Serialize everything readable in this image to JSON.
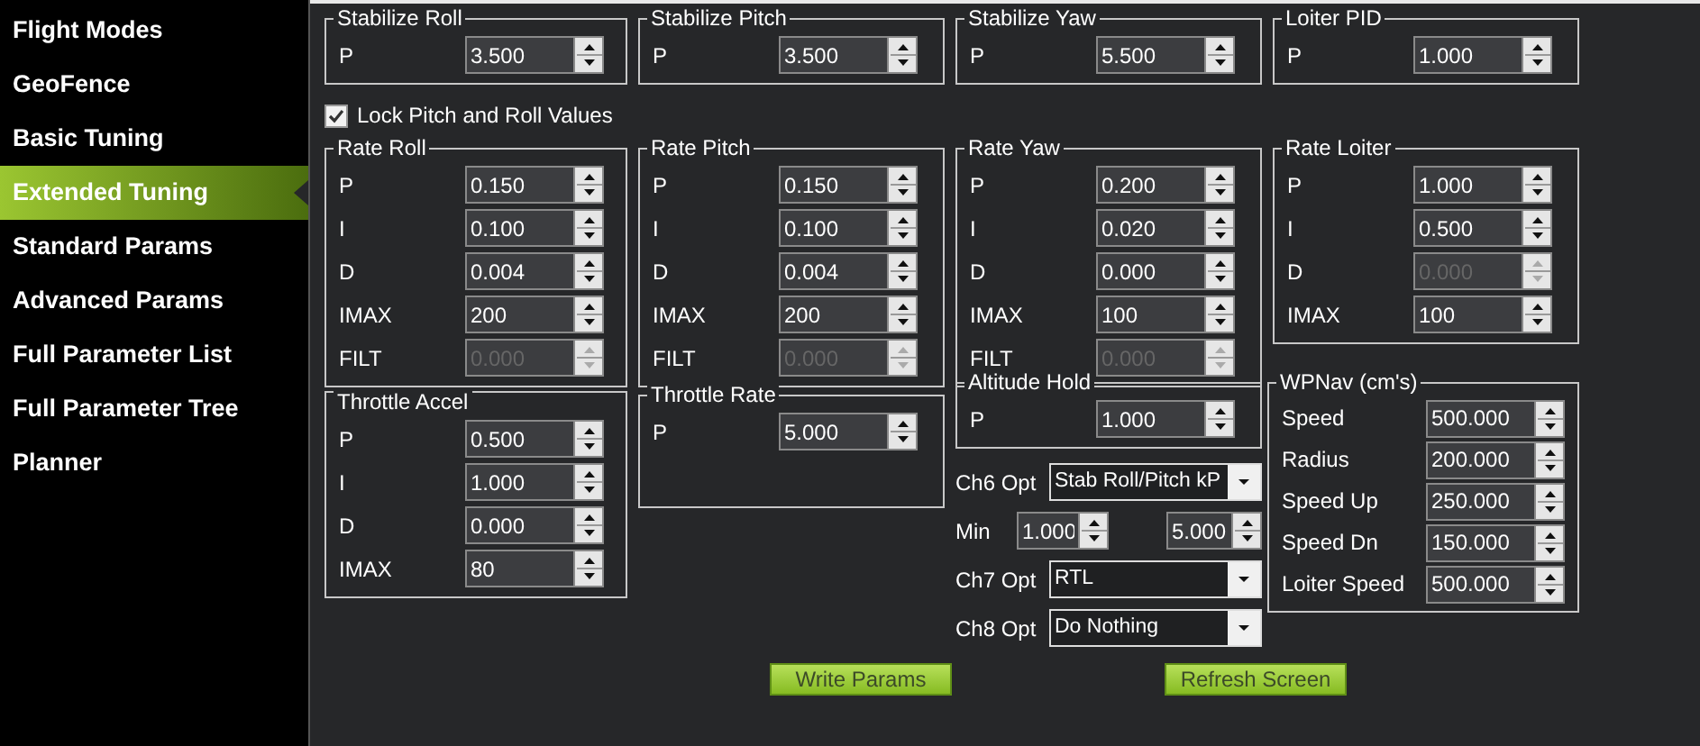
{
  "sidebar": {
    "items": [
      {
        "label": "Flight Modes",
        "selected": false
      },
      {
        "label": "GeoFence",
        "selected": false
      },
      {
        "label": "Basic Tuning",
        "selected": false
      },
      {
        "label": "Extended Tuning",
        "selected": true
      },
      {
        "label": "Standard Params",
        "selected": false
      },
      {
        "label": "Advanced Params",
        "selected": false
      },
      {
        "label": "Full Parameter List",
        "selected": false
      },
      {
        "label": "Full Parameter Tree",
        "selected": false
      },
      {
        "label": "Planner",
        "selected": false
      }
    ]
  },
  "groups_top": [
    {
      "title": "Stabilize Roll",
      "fields": [
        {
          "label": "P",
          "value": "3.500",
          "disabled": false
        }
      ]
    },
    {
      "title": "Stabilize Pitch",
      "fields": [
        {
          "label": "P",
          "value": "3.500",
          "disabled": false
        }
      ]
    },
    {
      "title": "Stabilize Yaw",
      "fields": [
        {
          "label": "P",
          "value": "5.500",
          "disabled": false
        }
      ]
    },
    {
      "title": "Loiter PID",
      "fields": [
        {
          "label": "P",
          "value": "1.000",
          "disabled": false
        }
      ]
    }
  ],
  "lock_option": {
    "label": "Lock Pitch and Roll Values",
    "checked": true
  },
  "groups_rate": [
    {
      "title": "Rate Roll",
      "fields": [
        {
          "label": "P",
          "value": "0.150",
          "disabled": false
        },
        {
          "label": "I",
          "value": "0.100",
          "disabled": false
        },
        {
          "label": "D",
          "value": "0.004",
          "disabled": false
        },
        {
          "label": "IMAX",
          "value": "200",
          "disabled": false
        },
        {
          "label": "FILT",
          "value": "0.000",
          "disabled": true
        }
      ]
    },
    {
      "title": "Rate Pitch",
      "fields": [
        {
          "label": "P",
          "value": "0.150",
          "disabled": false
        },
        {
          "label": "I",
          "value": "0.100",
          "disabled": false
        },
        {
          "label": "D",
          "value": "0.004",
          "disabled": false
        },
        {
          "label": "IMAX",
          "value": "200",
          "disabled": false
        },
        {
          "label": "FILT",
          "value": "0.000",
          "disabled": true
        }
      ]
    },
    {
      "title": "Rate Yaw",
      "fields": [
        {
          "label": "P",
          "value": "0.200",
          "disabled": false
        },
        {
          "label": "I",
          "value": "0.020",
          "disabled": false
        },
        {
          "label": "D",
          "value": "0.000",
          "disabled": false
        },
        {
          "label": "IMAX",
          "value": "100",
          "disabled": false
        },
        {
          "label": "FILT",
          "value": "0.000",
          "disabled": true
        }
      ]
    },
    {
      "title": "Rate Loiter",
      "fields": [
        {
          "label": "P",
          "value": "1.000",
          "disabled": false
        },
        {
          "label": "I",
          "value": "0.500",
          "disabled": false
        },
        {
          "label": "D",
          "value": "0.000",
          "disabled": true
        },
        {
          "label": "IMAX",
          "value": "100",
          "disabled": false
        }
      ]
    }
  ],
  "groups_lower": [
    {
      "title": "Throttle Accel",
      "fields": [
        {
          "label": "P",
          "value": "0.500",
          "disabled": false
        },
        {
          "label": "I",
          "value": "1.000",
          "disabled": false
        },
        {
          "label": "D",
          "value": "0.000",
          "disabled": false
        },
        {
          "label": "IMAX",
          "value": "80",
          "disabled": false
        }
      ]
    },
    {
      "title": "Throttle Rate",
      "fields": [
        {
          "label": "P",
          "value": "5.000",
          "disabled": false
        }
      ]
    },
    {
      "title": "Altitude Hold",
      "fields": [
        {
          "label": "P",
          "value": "1.000",
          "disabled": false
        }
      ]
    }
  ],
  "channel_options": {
    "ch6": {
      "label": "Ch6 Opt",
      "value": "Stab Roll/Pitch kP"
    },
    "range": {
      "label": "Min",
      "min": "1.000",
      "max": "5.000"
    },
    "ch7": {
      "label": "Ch7 Opt",
      "value": "RTL"
    },
    "ch8": {
      "label": "Ch8 Opt",
      "value": "Do Nothing"
    }
  },
  "wpnav": {
    "title": "WPNav (cm's)",
    "fields": [
      {
        "label": "Speed",
        "value": "500.000",
        "disabled": false
      },
      {
        "label": "Radius",
        "value": "200.000",
        "disabled": false
      },
      {
        "label": "Speed Up",
        "value": "250.000",
        "disabled": false
      },
      {
        "label": "Speed Dn",
        "value": "150.000",
        "disabled": false
      },
      {
        "label": "Loiter Speed",
        "value": "500.000",
        "disabled": false
      }
    ]
  },
  "buttons": [
    "Write Params",
    "Refresh Screen"
  ]
}
